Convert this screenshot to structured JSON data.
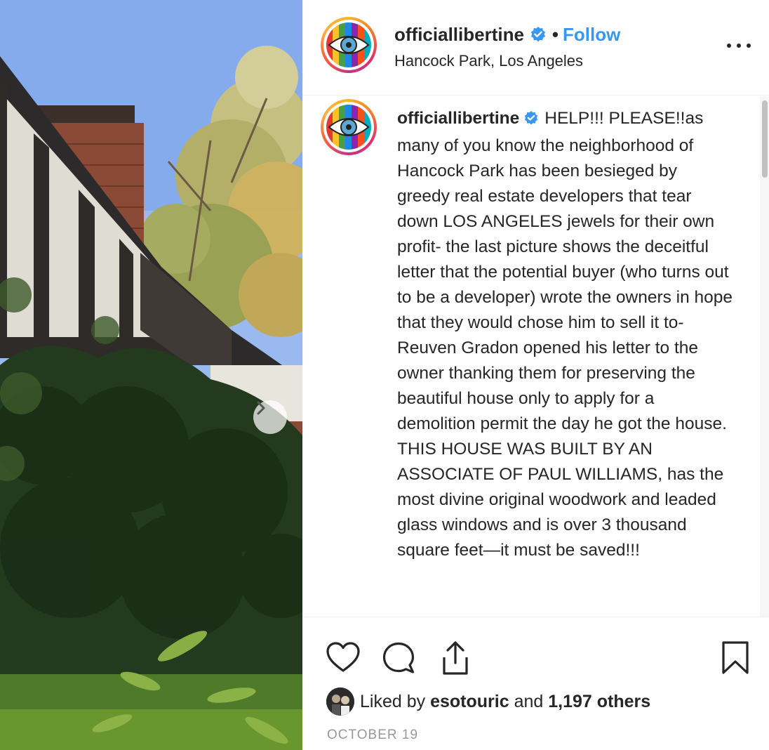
{
  "post": {
    "username": "officiallibertine",
    "separator": "•",
    "follow_label": "Follow",
    "location": "Hancock Park, Los Angeles",
    "more_icon": "ellipsis-icon",
    "verified_icon": "verified-badge-icon"
  },
  "caption": {
    "username": "officiallibertine",
    "text": "HELP!!! PLEASE!!as many of you know the neighborhood of Hancock Park has been besieged by greedy real estate developers that tear down LOS ANGELES jewels for their own profit- the last picture shows the deceitful letter that the potential buyer (who turns out to be a developer) wrote the owners in hope that they would chose him to sell it to- Reuven Gradon opened his letter to the owner thanking them for preserving the beautiful house only to apply for a demolition permit the day he got the house. THIS HOUSE WAS BUILT BY AN ASSOCIATE OF PAUL WILLIAMS, has the most divine original woodwork and leaded glass windows and is over 3 thousand square feet—it must be saved!!!"
  },
  "actions": {
    "like_icon": "heart-icon",
    "comment_icon": "comment-bubble-icon",
    "share_icon": "share-icon",
    "save_icon": "bookmark-icon"
  },
  "likes": {
    "prefix": "Liked by",
    "user": "esotouric",
    "conjunction": "and",
    "others": "1,197 others"
  },
  "date": "October 19",
  "colors": {
    "accent": "#3897f0",
    "text": "#262626",
    "muted": "#999999",
    "divider": "#efefef"
  }
}
